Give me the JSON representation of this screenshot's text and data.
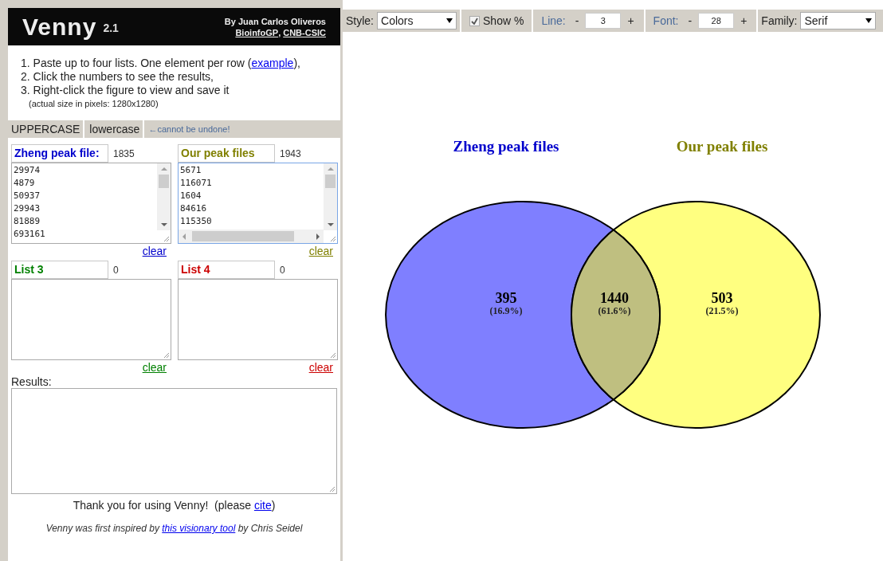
{
  "header": {
    "title": "Venny",
    "version": "2.1",
    "author": "By Juan Carlos Oliveros",
    "links": [
      "BioinfoGP",
      "CNB-CSIC"
    ],
    "separator": ","
  },
  "instructions": [
    {
      "text": "1. Paste up to four lists. One element per row (",
      "link": "example",
      "after": "),"
    },
    {
      "text": "2. Click the numbers to see the results,"
    },
    {
      "text": "3. Right-click the figure to view and save it"
    }
  ],
  "note": "(actual size in pixels: 1280x1280)",
  "case_buttons": [
    "UPPERCASE",
    "lowercase"
  ],
  "case_warning": "←cannot be undone!",
  "lists": [
    {
      "name": "Zheng peak file:",
      "count": "1835",
      "color": "#0000cc",
      "clear": "clear",
      "lines": [
        "29974",
        "4879",
        "50937",
        "29943",
        "81889",
        "693161"
      ],
      "focused": false,
      "hscroll": false,
      "vscroll": true
    },
    {
      "name": "Our peak files",
      "count": "1943",
      "color": "#808000",
      "clear": "clear",
      "lines": [
        "5671",
        "116071",
        "1604",
        "84616",
        "115350"
      ],
      "focused": true,
      "hscroll": true,
      "vscroll": true
    },
    {
      "name": "List 3",
      "count": "0",
      "color": "#008000",
      "clear": "clear",
      "focused": false,
      "hscroll": false,
      "vscroll": false
    },
    {
      "name": "List 4",
      "count": "0",
      "color": "#cc0000",
      "clear": "clear",
      "focused": false,
      "hscroll": false,
      "vscroll": false
    }
  ],
  "results_label": "Results:",
  "thanks": {
    "text": "Thank you for using Venny!  (please ",
    "link": "cite",
    "after": ")"
  },
  "inspired": {
    "text": "Venny was first inspired by ",
    "link": "this visionary tool",
    "after": " by Chris Seidel"
  },
  "toolbar": {
    "style_label": "Style:",
    "style_value": "Colors",
    "show_percent": {
      "label": "Show %",
      "checked": true
    },
    "line_label": "Line:",
    "line_value": "3",
    "font_label": "Font:",
    "font_value": "28",
    "minus": "-",
    "plus": "+",
    "family_label": "Family:",
    "family_value": "Serif"
  },
  "venn": {
    "sets": [
      {
        "name": "Zheng peak files",
        "color": "#7f7fff"
      },
      {
        "name": "Our peak files",
        "color": "#ffff80"
      }
    ],
    "regions": [
      {
        "count": "395",
        "percent": "(16.9%)"
      },
      {
        "count": "1440",
        "percent": "(61.6%)"
      },
      {
        "count": "503",
        "percent": "(21.5%)"
      }
    ]
  }
}
